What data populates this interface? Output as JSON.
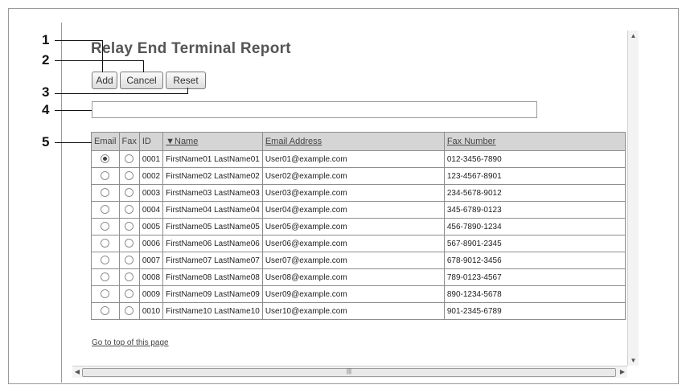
{
  "page": {
    "title": "Relay End Terminal Report"
  },
  "buttons": {
    "add": "Add",
    "cancel": "Cancel",
    "reset": "Reset"
  },
  "search": {
    "value": ""
  },
  "table": {
    "headers": [
      "Email",
      "Fax",
      "ID",
      "▼Name",
      "Email Address",
      "Fax Number"
    ],
    "rows": [
      {
        "id": "0001",
        "name": "FirstName01 LastName01",
        "email": "User01@example.com",
        "fax": "012-3456-7890",
        "email_selected": true
      },
      {
        "id": "0002",
        "name": "FirstName02 LastName02",
        "email": "User02@example.com",
        "fax": "123-4567-8901",
        "email_selected": false
      },
      {
        "id": "0003",
        "name": "FirstName03 LastName03",
        "email": "User03@example.com",
        "fax": "234-5678-9012",
        "email_selected": false
      },
      {
        "id": "0004",
        "name": "FirstName04 LastName04",
        "email": "User04@example.com",
        "fax": "345-6789-0123",
        "email_selected": false
      },
      {
        "id": "0005",
        "name": "FirstName05 LastName05",
        "email": "User05@example.com",
        "fax": "456-7890-1234",
        "email_selected": false
      },
      {
        "id": "0006",
        "name": "FirstName06 LastName06",
        "email": "User06@example.com",
        "fax": "567-8901-2345",
        "email_selected": false
      },
      {
        "id": "0007",
        "name": "FirstName07 LastName07",
        "email": "User07@example.com",
        "fax": "678-9012-3456",
        "email_selected": false
      },
      {
        "id": "0008",
        "name": "FirstName08 LastName08",
        "email": "User08@example.com",
        "fax": "789-0123-4567",
        "email_selected": false
      },
      {
        "id": "0009",
        "name": "FirstName09 LastName09",
        "email": "User09@example.com",
        "fax": "890-1234-5678",
        "email_selected": false
      },
      {
        "id": "0010",
        "name": "FirstName10 LastName10",
        "email": "User10@example.com",
        "fax": "901-2345-6789",
        "email_selected": false
      }
    ]
  },
  "footer": {
    "go_top": "Go to top of this page"
  },
  "callouts": [
    "1",
    "2",
    "3",
    "4",
    "5"
  ]
}
